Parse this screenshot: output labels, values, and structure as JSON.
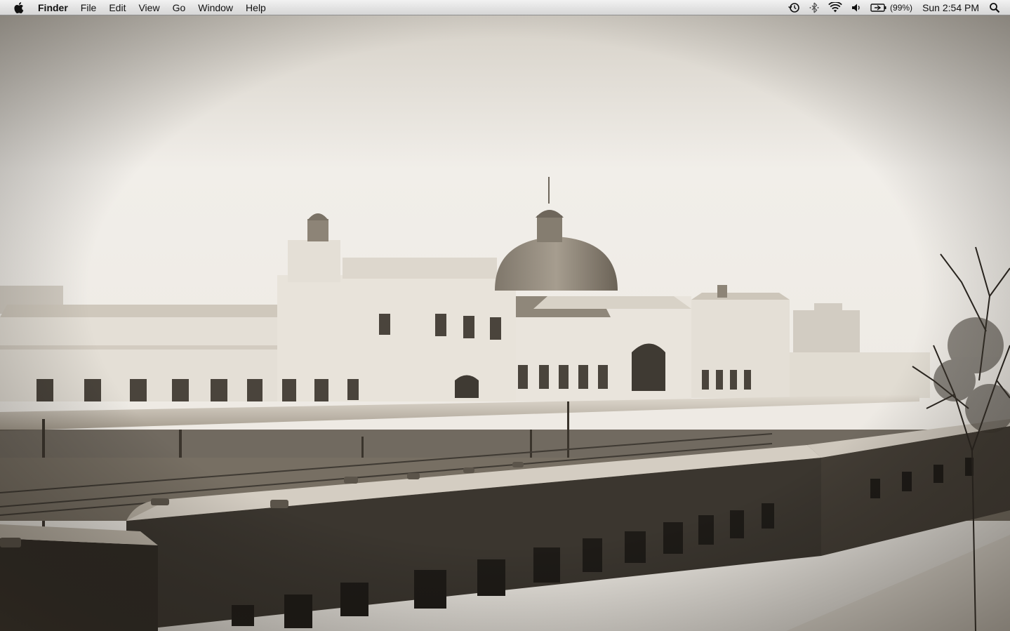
{
  "menubar": {
    "app_name": "Finder",
    "menus": [
      "File",
      "Edit",
      "View",
      "Go",
      "Window",
      "Help"
    ],
    "status_icons": [
      "time-machine-icon",
      "bluetooth-icon",
      "wifi-icon",
      "volume-icon",
      "battery-icon"
    ],
    "battery_percent": "(99%)",
    "clock": "Sun 2:54 PM",
    "spotlight_icon": "spotlight-search-icon"
  },
  "desktop": {
    "wallpaper": "sepia photo of snowy railway station with trains",
    "colors": {
      "sky": "#efece6",
      "building": "#e6e1d8",
      "train_roof": "#cfc8bd",
      "train_body": "#3b362f"
    }
  }
}
